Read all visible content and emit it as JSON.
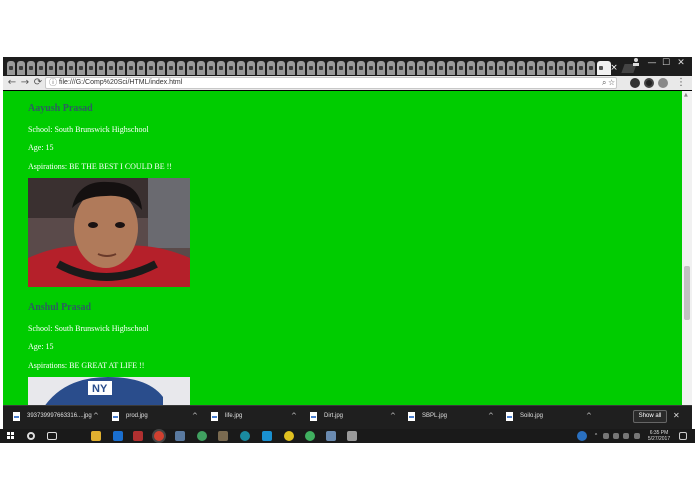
{
  "browser": {
    "url": "file:///G:/Comp%20Sci/HTML/index.html",
    "tab_close": "×",
    "window_controls": {
      "minimize": "—",
      "maximize": "☐",
      "close": "✕"
    },
    "nav": {
      "back": "←",
      "forward": "→",
      "reload": "⟳"
    },
    "info_icon": "ⓘ",
    "zoom_icon": "⌕",
    "star_icon": "☆",
    "menu_icon": "⋮"
  },
  "page": {
    "profiles": [
      {
        "name": "Aayush Prasad",
        "school": "School: South Brunswick Highschool",
        "age": "Age: 15",
        "aspirations": "Aspirations: BE THE BEST I COULD BE !!"
      },
      {
        "name": "Anshul Prasad",
        "school": "School: South Brunswick Highschool",
        "age": "Age: 15",
        "aspirations": "Aspirations: BE GREAT AT LIFE !!"
      }
    ],
    "background_color": "#00cc00",
    "name_color": "#2c5f5f"
  },
  "downloads": {
    "items": [
      {
        "name": "393739997663316....jpg"
      },
      {
        "name": "prod.jpg"
      },
      {
        "name": "life.jpg"
      },
      {
        "name": "Dirt.jpg"
      },
      {
        "name": "SBPL.jpg"
      },
      {
        "name": "Soilo.jpg"
      }
    ],
    "caret": "^",
    "show_all": "Show all",
    "close": "✕"
  },
  "taskbar": {
    "time": "6:35 PM",
    "date": "5/27/2017"
  }
}
